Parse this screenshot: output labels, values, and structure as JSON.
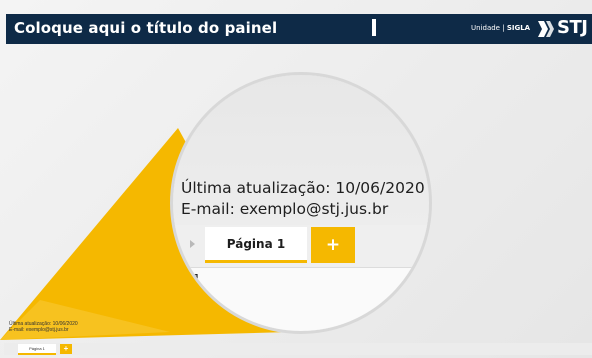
{
  "header": {
    "title": "Coloque aqui o título do painel",
    "unit_label": "Unidade |",
    "sigla": "SIGLA",
    "logo_text": "STJ"
  },
  "status": {
    "last_update": "Última atualização: 10/06/2020",
    "email": "E-mail: exemplo@stj.jus.br"
  },
  "tabs": {
    "page_label": "Página 1",
    "add_symbol": "+"
  },
  "page_number": "1",
  "colors": {
    "header_bg": "#0e2a47",
    "accent_yellow": "#f5b800"
  },
  "icons": {
    "nav_prev": "triangle-right-icon",
    "add": "plus-icon",
    "logo": "stj-logo-icon"
  }
}
